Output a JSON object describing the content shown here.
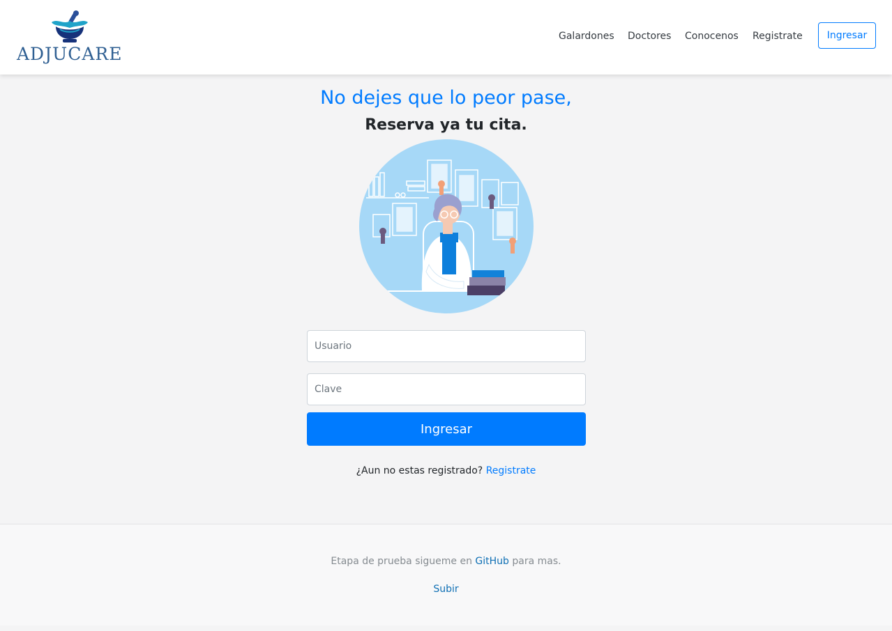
{
  "brand": {
    "name": "ADJUCARE",
    "logo_icon": "mortar-pestle-icon"
  },
  "nav": {
    "links": [
      "Galardones",
      "Doctores",
      "Conocenos",
      "Registrate"
    ],
    "login_button": "Ingresar"
  },
  "hero": {
    "title": "No dejes que lo peor pase,",
    "subtitle": "Reserva ya tu cita.",
    "illustration_icon": "doctor-illustration-icon"
  },
  "login_form": {
    "username_placeholder": "Usuario",
    "username_value": "",
    "password_placeholder": "Clave",
    "password_value": "",
    "submit_label": "Ingresar"
  },
  "register_prompt": {
    "text": "¿Aun no estas registrado?",
    "link": "Registrate"
  },
  "footer": {
    "text_before": "Etapa de prueba sigueme en",
    "link": "GitHub",
    "text_after": "para mas.",
    "back_to_top": "Subir"
  },
  "colors": {
    "primary": "#007bff",
    "page_background": "#f4f4f5",
    "footer_background": "#f8f8f9",
    "brand_text": "#2f5f92"
  }
}
